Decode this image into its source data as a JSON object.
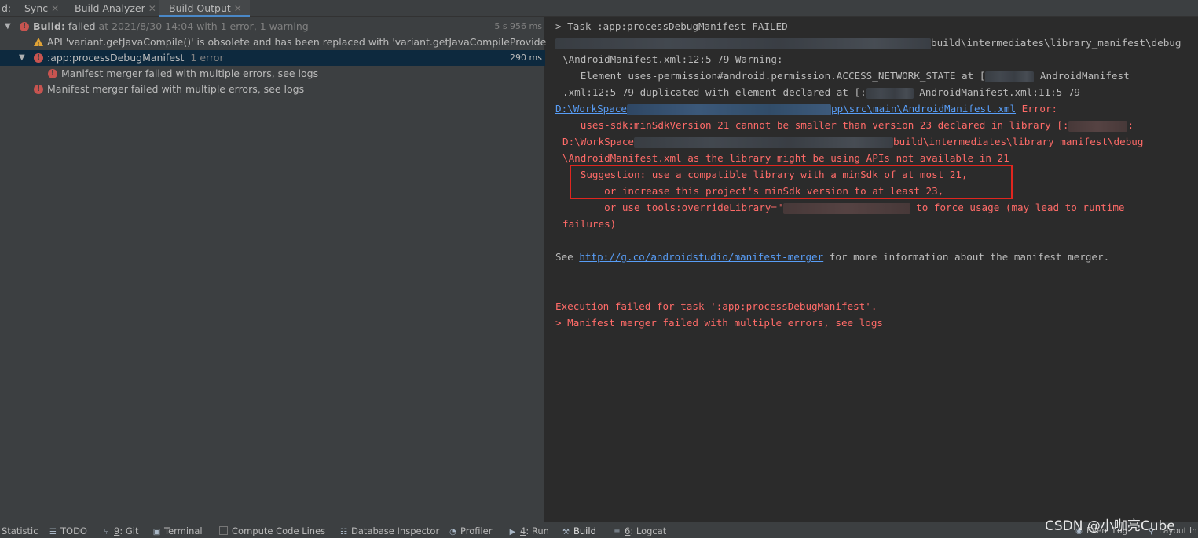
{
  "tabbar": {
    "prefix": "d:",
    "tabs": [
      {
        "label": "Sync"
      },
      {
        "label": "Build Analyzer"
      },
      {
        "label": "Build Output"
      }
    ]
  },
  "tree": {
    "build": {
      "bold": "Build:",
      "status": " failed",
      "detail": " at 2021/8/30 14:04 with 1 error, 1 warning",
      "time": "5 s 956 ms"
    },
    "warning": {
      "text": "API 'variant.getJavaCompile()' is obsolete and has been replaced with 'variant.getJavaCompileProvider()'."
    },
    "task": {
      "name": ":app:processDebugManifest",
      "count": "1 error",
      "time": "290 ms"
    },
    "task_child": {
      "text": "Manifest merger failed with multiple errors, see logs"
    },
    "root_error": {
      "text": "Manifest merger failed with multiple errors, see logs"
    }
  },
  "console": {
    "l1": "> Task :app:processDebugManifest FAILED",
    "l2b": "build\\intermediates\\library_manifest\\debug",
    "l3": "\\AndroidManifest.xml:12:5-79 Warning:",
    "l4a": "   Element uses-permission#android.permission.ACCESS_NETWORK_STATE at [",
    "l4b": "AndroidManifest",
    "l5a": ".xml:12:5-79 duplicated with element declared at [:",
    "l5b": "AndroidManifest.xml:11:5-79",
    "l6a": "D:\\WorkSpace",
    "l6b": "pp\\src\\main\\AndroidManifest.xml",
    "l6c": " Error:",
    "l7a": "   uses-sdk:minSdkVersion 21 cannot be smaller than version 23 declared in library [:",
    "l7b": ":",
    "l8a": "D:\\WorkSpace",
    "l8b": "build\\intermediates\\library_manifest\\debug",
    "l9": "\\AndroidManifest.xml as the library might be using APIs not available in 21",
    "l10": "   Suggestion: use a compatible library with a minSdk of at most 21,",
    "l11": "       or increase this project's minSdk version to at least 23,",
    "l12a": "       or use tools:overrideLibrary=\"",
    "l12b": " to force usage (may lead to runtime",
    "l13": "failures)",
    "see_pre": "See ",
    "see_link": "http://g.co/androidstudio/manifest-merger",
    "see_post": " for more information about the manifest merger.",
    "exec1": "Execution failed for task ':app:processDebugManifest'.",
    "exec2": "> Manifest merger failed with multiple errors, see logs"
  },
  "statusbar": {
    "items": [
      {
        "label": "Statistic"
      },
      {
        "label": "TODO"
      },
      {
        "num": "9",
        "label": ": Git"
      },
      {
        "label": "Terminal"
      },
      {
        "label": "Compute Code Lines"
      },
      {
        "label": "Database Inspector"
      },
      {
        "label": "Profiler"
      },
      {
        "num": "4",
        "label": ": Run"
      },
      {
        "label": "Build"
      },
      {
        "num": "6",
        "label": ": Logcat"
      },
      {
        "label": "Event Log"
      },
      {
        "label": "Layout In"
      }
    ]
  },
  "watermark": "CSDN @小咖亮Cube"
}
